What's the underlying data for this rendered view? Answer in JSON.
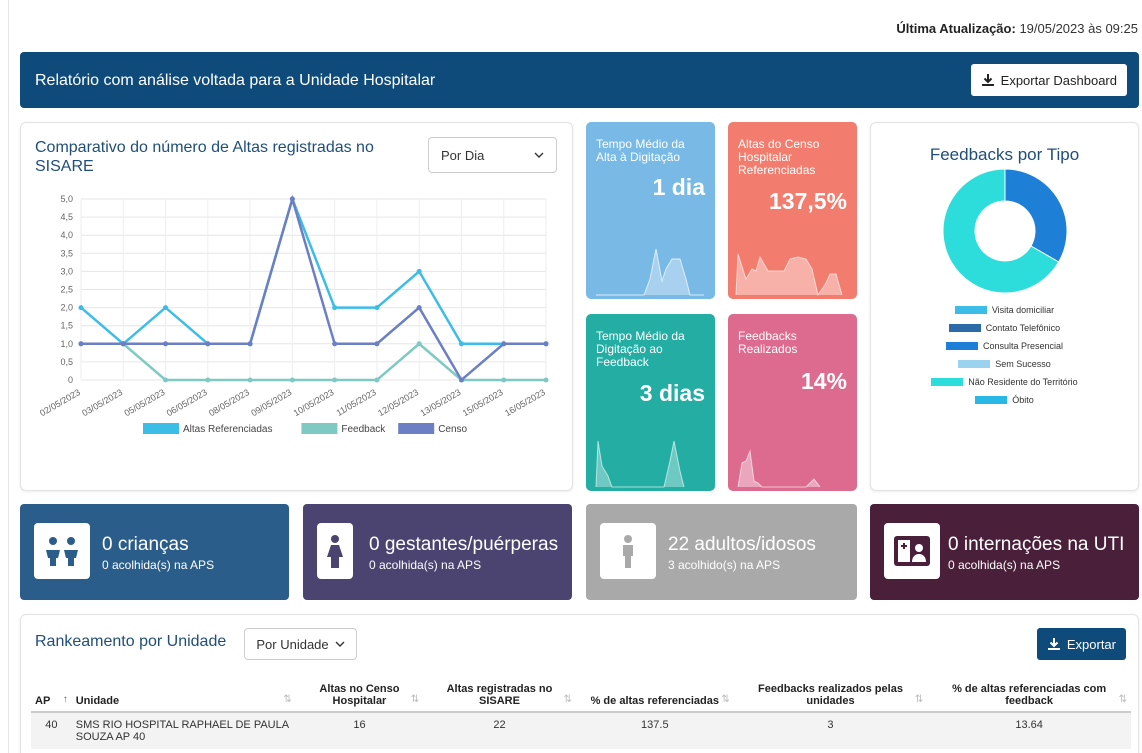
{
  "header": {
    "update_label": "Última Atualização:",
    "update_value": "19/05/2023 às 09:25"
  },
  "banner": {
    "title": "Relatório com análise voltada para a Unidade Hospitalar",
    "export_label": "Exportar Dashboard"
  },
  "line_chart": {
    "title": "Comparativo do número de Altas registradas no SISARE",
    "select_value": "Por Dia"
  },
  "kpis": [
    {
      "label": "Tempo Médio da Alta à Digitação",
      "value": "1 dia",
      "color": "#78b9e5"
    },
    {
      "label": "Altas do Censo Hospitalar Referenciadas",
      "value": "137,5%",
      "color": "#f27d6e"
    },
    {
      "label": "Tempo Médio da Digitação ao Feedback",
      "value": "3 dias",
      "color": "#23ada3"
    },
    {
      "label": "Feedbacks Realizados",
      "value": "14%",
      "color": "#dd6b8f"
    }
  ],
  "pie": {
    "title": "Feedbacks por Tipo"
  },
  "stats": [
    {
      "big": "0 crianças",
      "small": "0 acolhida(s) na APS",
      "color": "#2b5d8a",
      "icon": "children-icon"
    },
    {
      "big": "0 gestantes/puérperas",
      "small": "0 acolhida(s) na APS",
      "color": "#4b4370",
      "icon": "pregnant-icon"
    },
    {
      "big": "22 adultos/idosos",
      "small": "3 acolhido(s) na APS",
      "color": "#a9a9a9",
      "icon": "adult-icon"
    },
    {
      "big": "0 internações na UTI",
      "small": "0 acolhida(s) na APS",
      "color": "#4a1f3a",
      "icon": "icu-icon"
    }
  ],
  "ranking": {
    "title": "Rankeamento por Unidade",
    "select_value": "Por Unidade",
    "export_label": "Exportar",
    "columns": [
      "AP",
      "Unidade",
      "Altas no Censo Hospitalar",
      "Altas registradas no SISARE",
      "% de altas referenciadas",
      "Feedbacks realizados pelas unidades",
      "% de altas referenciadas com feedback"
    ],
    "rows": [
      [
        "40",
        "SMS RIO HOSPITAL RAPHAEL DE PAULA SOUZA AP 40",
        "16",
        "22",
        "137.5",
        "3",
        "13.64"
      ]
    ]
  },
  "chart_data": [
    {
      "type": "line",
      "title": "Comparativo do número de Altas registradas no SISARE",
      "categories": [
        "02/05/2023",
        "03/05/2023",
        "05/05/2023",
        "06/05/2023",
        "08/05/2023",
        "09/05/2023",
        "10/05/2023",
        "11/05/2023",
        "12/05/2023",
        "13/05/2023",
        "15/05/2023",
        "16/05/2023"
      ],
      "ylim": [
        0,
        5
      ],
      "yticks": [
        "0",
        "0,5",
        "1,0",
        "1,5",
        "2,0",
        "2,5",
        "3,0",
        "3,5",
        "4,0",
        "4,5",
        "5,0"
      ],
      "grid": true,
      "legend": "bottom",
      "series": [
        {
          "name": "Altas Referenciadas",
          "color": "#3bbde8",
          "values": [
            2,
            1,
            2,
            1,
            1,
            5,
            2,
            2,
            3,
            1,
            1,
            1
          ]
        },
        {
          "name": "Feedback",
          "color": "#7ecac3",
          "values": [
            1,
            1,
            0,
            0,
            0,
            0,
            0,
            0,
            1,
            0,
            0,
            0
          ]
        },
        {
          "name": "Censo",
          "color": "#6c7fc4",
          "values": [
            1,
            1,
            1,
            1,
            1,
            5,
            1,
            1,
            2,
            0,
            1,
            1
          ]
        }
      ]
    },
    {
      "type": "pie",
      "title": "Feedbacks por Tipo",
      "legend": "bottom",
      "categories": [
        "Visita domiciliar",
        "Contato Telefônico",
        "Consulta Presencial",
        "Sem Sucesso",
        "Não Residente do Território",
        "Óbito"
      ],
      "values": [
        0,
        0,
        1,
        0,
        2,
        0
      ],
      "colors": [
        "#3bbde8",
        "#2d6aa8",
        "#1e7fd6",
        "#9bd3ef",
        "#2ddddb",
        "#29b8e6"
      ]
    }
  ]
}
